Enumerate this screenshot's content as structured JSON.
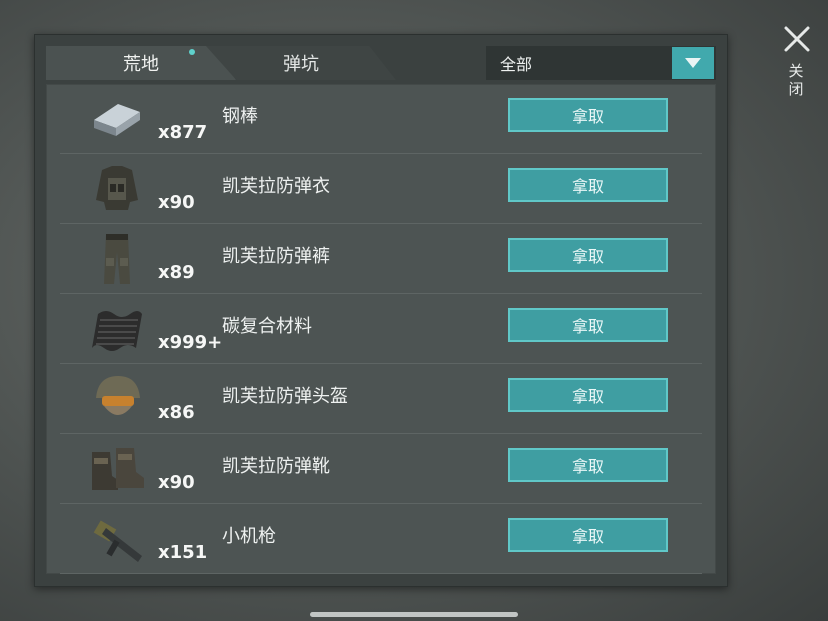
{
  "tabs": [
    {
      "label": "荒地",
      "active": true,
      "has_dot": true
    },
    {
      "label": "弹坑",
      "active": false
    }
  ],
  "filter": {
    "selected": "全部"
  },
  "items": [
    {
      "icon": "steel-bar-icon",
      "name": "钢棒",
      "count": "x877",
      "button": "拿取"
    },
    {
      "icon": "armor-vest-icon",
      "name": "凯芙拉防弹衣",
      "count": "x90",
      "button": "拿取"
    },
    {
      "icon": "armor-pants-icon",
      "name": "凯芙拉防弹裤",
      "count": "x89",
      "button": "拿取"
    },
    {
      "icon": "carbon-sheet-icon",
      "name": "碳复合材料",
      "count": "x999+",
      "button": "拿取"
    },
    {
      "icon": "helmet-icon",
      "name": "凯芙拉防弹头盔",
      "count": "x86",
      "button": "拿取"
    },
    {
      "icon": "boots-icon",
      "name": "凯芙拉防弹靴",
      "count": "x90",
      "button": "拿取"
    },
    {
      "icon": "gun-icon",
      "name": "小机枪",
      "count": "x151",
      "button": "拿取"
    }
  ],
  "close": {
    "label": "关闭",
    "icon": "close-icon"
  },
  "colors": {
    "accent": "#41a9ad",
    "panel": "#3b4140",
    "list": "#4d5453"
  }
}
